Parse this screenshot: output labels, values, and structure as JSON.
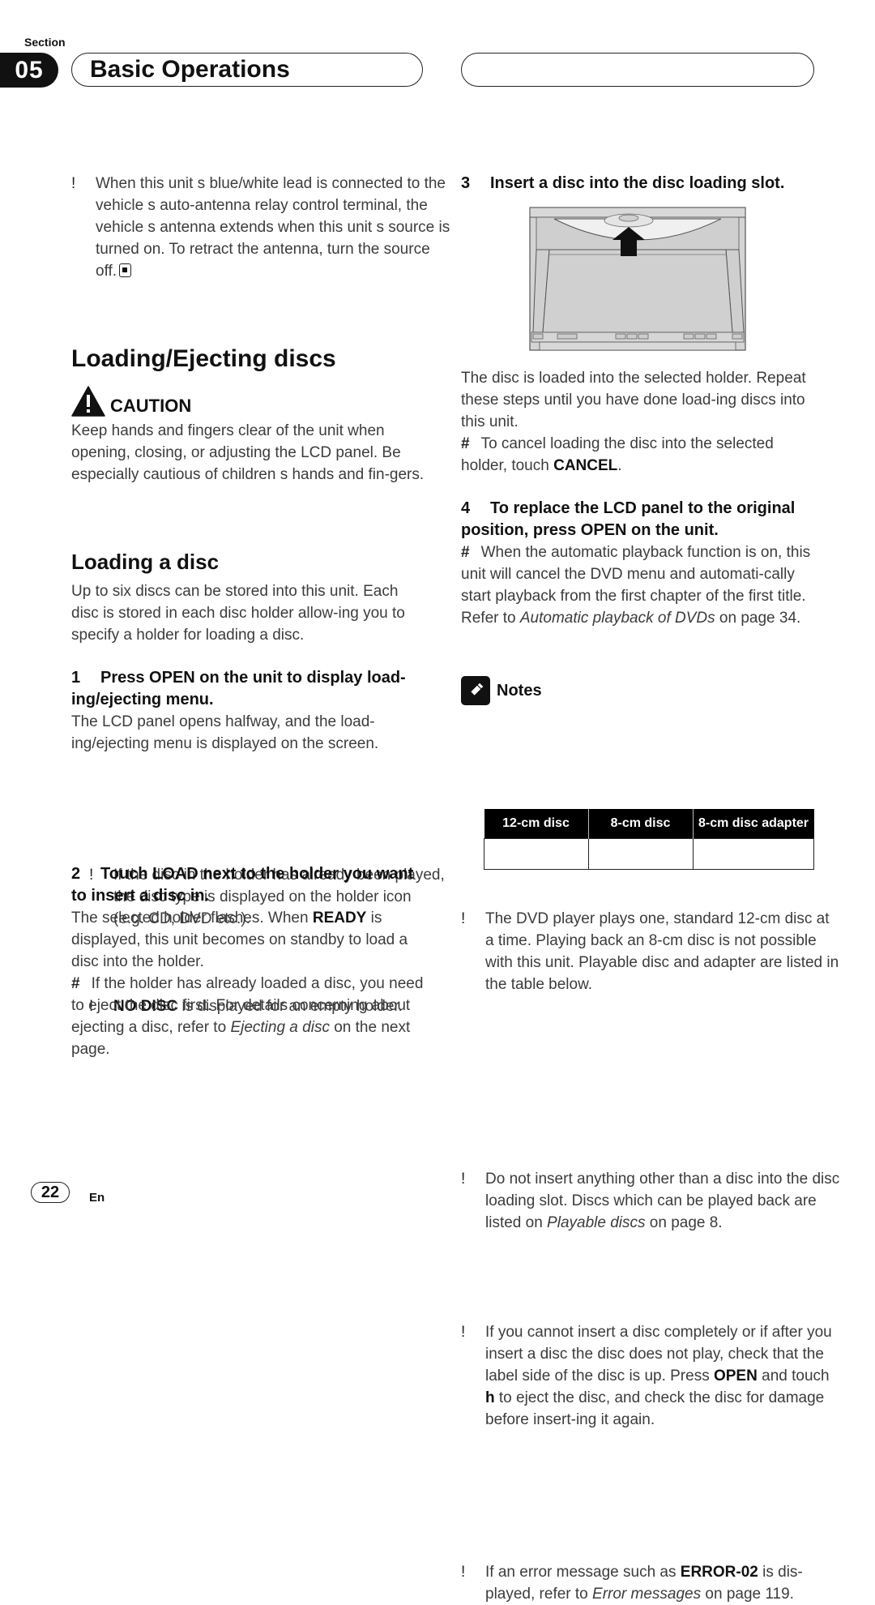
{
  "header": {
    "section_label": "Section",
    "section_number": "05",
    "section_title": "Basic Operations"
  },
  "left": {
    "intro_bullet": {
      "mark": "!",
      "text": "When this unit s blue/white lead is connected to the vehicle s auto-antenna relay control terminal, the vehicle s antenna extends when this unit s source is turned on. To retract the antenna, turn the source off."
    },
    "heading_loading_ejecting": "Loading/Ejecting discs",
    "caution": {
      "label": "CAUTION",
      "text": "Keep hands and fingers clear of the unit when opening, closing, or adjusting the LCD panel. Be especially cautious of children s hands and fin-gers."
    },
    "heading_loading_disc": "Loading a disc",
    "loading_intro": "Up to six discs can be stored into this unit. Each disc is stored in each disc holder allow-ing you to specify a holder for loading a disc.",
    "step1": {
      "num": "1",
      "title": "Press OPEN on the unit to display load-ing/ejecting menu.",
      "text": "The LCD panel opens halfway, and the load-ing/ejecting menu is displayed on the screen.",
      "bullets": [
        {
          "mark": "!",
          "text": "If the disc in the holder has already been played, the disc type is displayed on the holder icon (e.g. CD, DVD etc.)."
        },
        {
          "mark": "!",
          "bold": "NO DISC",
          "text": " is displayed for an empty holder."
        }
      ]
    },
    "step2": {
      "num": "2",
      "title": "Touch LOAD next to the holder you want to insert a disc in.",
      "text_pre": "The selected holder flashes. When ",
      "text_bold": "READY",
      "text_post": " is displayed, this unit becomes on standby to load a disc into the holder.",
      "hash_mark": "#",
      "hash_pre": "If the holder has already loaded a disc, you need to eject the disc first. For details concerning about ejecting a disc, refer to ",
      "hash_italic": "Ejecting a disc",
      "hash_post": " on the next page."
    }
  },
  "right": {
    "step3": {
      "num": "3",
      "title": "Insert a disc into the disc loading slot.",
      "illustration": "disc-insertion-illustration",
      "text": "The disc is loaded into the selected holder. Repeat these steps until you have done load-ing discs into this unit.",
      "hash_mark": "#",
      "hash_pre": "To cancel loading the disc into the selected holder, touch ",
      "hash_bold": "CANCEL",
      "hash_post": "."
    },
    "step4": {
      "num": "4",
      "title": "To replace the LCD panel to the original position, press OPEN on the unit.",
      "hash_mark": "#",
      "hash_pre": "When the automatic playback function is on, this unit will cancel the DVD menu and automati-cally start playback from the first chapter of the first title. Refer to ",
      "hash_italic": "Automatic playback of DVDs",
      "hash_post": " on page 34."
    },
    "notes": {
      "label": "Notes",
      "bullet1": {
        "mark": "!",
        "text": "The DVD player plays one, standard 12-cm disc at a time. Playing back an 8-cm disc is not possible with this unit. Playable disc and adapter are listed in the table below."
      },
      "table": {
        "headers": [
          "12-cm disc",
          "8-cm disc",
          "8-cm disc adapter"
        ],
        "rows": [
          [
            "",
            "",
            ""
          ]
        ]
      },
      "bullet2": {
        "mark": "!",
        "pre": "Do not insert anything other than a disc into the disc loading slot. Discs which can be played back are listed on ",
        "italic": "Playable discs",
        "post": " on page 8."
      },
      "bullet3": {
        "mark": "!",
        "pre": "If you cannot insert a disc completely or if after you insert a disc the disc does not play, check that the label side of the disc is up. Press ",
        "bold1": "OPEN",
        "mid": " and touch ",
        "bold2": "h",
        "post": "  to eject the disc, and check the disc for damage before insert-ing it again."
      },
      "bullet4": {
        "mark": "!",
        "pre": "If an error message such as ",
        "bold": "ERROR-02",
        "mid": " is dis-played, refer to ",
        "italic": "Error messages",
        "post": " on page 119."
      }
    }
  },
  "footer": {
    "page_number": "22",
    "language": "En"
  }
}
